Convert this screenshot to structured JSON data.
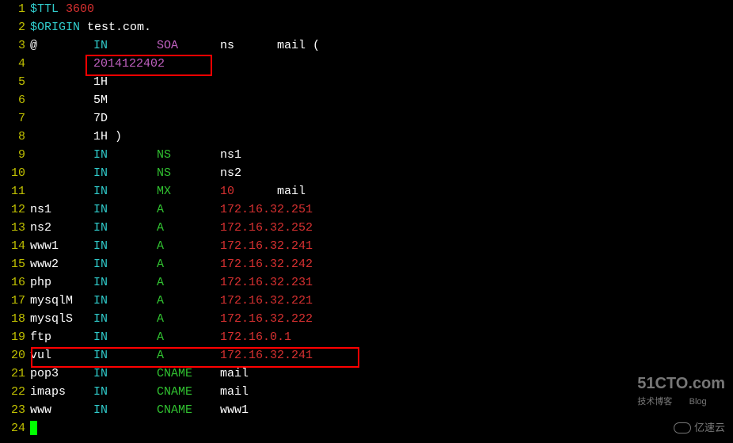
{
  "lines": [
    {
      "n": "1",
      "tokens": [
        {
          "t": "$TTL ",
          "c": "c-cyan"
        },
        {
          "t": "3600",
          "c": "c-red"
        }
      ]
    },
    {
      "n": "2",
      "tokens": [
        {
          "t": "$ORIGIN ",
          "c": "c-cyan"
        },
        {
          "t": "test.com.",
          "c": "c-white"
        }
      ]
    },
    {
      "n": "3",
      "name": "@",
      "class": "IN",
      "type": "SOA",
      "data": "ns      mail (",
      "nameC": "c-white",
      "classC": "c-cyan",
      "typeC": "c-purple",
      "dataC": "c-white"
    },
    {
      "n": "4",
      "indent": true,
      "tokens": [
        {
          "t": "2014122402",
          "c": "c-purple"
        }
      ]
    },
    {
      "n": "5",
      "indent": true,
      "tokens": [
        {
          "t": "1H",
          "c": "c-white"
        }
      ]
    },
    {
      "n": "6",
      "indent": true,
      "tokens": [
        {
          "t": "5M",
          "c": "c-white"
        }
      ]
    },
    {
      "n": "7",
      "indent": true,
      "tokens": [
        {
          "t": "7D",
          "c": "c-white"
        }
      ]
    },
    {
      "n": "8",
      "indent": true,
      "tokens": [
        {
          "t": "1H )",
          "c": "c-white"
        }
      ]
    },
    {
      "n": "9",
      "name": "",
      "class": "IN",
      "type": "NS",
      "data": "ns1",
      "classC": "c-cyan",
      "typeC": "c-green",
      "dataC": "c-white"
    },
    {
      "n": "10",
      "name": "",
      "class": "IN",
      "type": "NS",
      "data": "ns2",
      "classC": "c-cyan",
      "typeC": "c-green",
      "dataC": "c-white"
    },
    {
      "n": "11",
      "name": "",
      "class": "IN",
      "type": "MX",
      "data": "10      mail",
      "classC": "c-cyan",
      "typeC": "c-green",
      "dataC": "c-red",
      "dataTail": "mail",
      "dataTailC": "c-white"
    },
    {
      "n": "12",
      "name": "ns1",
      "class": "IN",
      "type": "A",
      "data": "172.16.32.251",
      "nameC": "c-white",
      "classC": "c-cyan",
      "typeC": "c-green",
      "dataC": "c-red"
    },
    {
      "n": "13",
      "name": "ns2",
      "class": "IN",
      "type": "A",
      "data": "172.16.32.252",
      "nameC": "c-white",
      "classC": "c-cyan",
      "typeC": "c-green",
      "dataC": "c-red"
    },
    {
      "n": "14",
      "name": "www1",
      "class": "IN",
      "type": "A",
      "data": "172.16.32.241",
      "nameC": "c-white",
      "classC": "c-cyan",
      "typeC": "c-green",
      "dataC": "c-red"
    },
    {
      "n": "15",
      "name": "www2",
      "class": "IN",
      "type": "A",
      "data": "172.16.32.242",
      "nameC": "c-white",
      "classC": "c-cyan",
      "typeC": "c-green",
      "dataC": "c-red"
    },
    {
      "n": "16",
      "name": "php",
      "class": "IN",
      "type": "A",
      "data": "172.16.32.231",
      "nameC": "c-white",
      "classC": "c-cyan",
      "typeC": "c-green",
      "dataC": "c-red"
    },
    {
      "n": "17",
      "name": "mysqlM",
      "class": "IN",
      "type": "A",
      "data": "172.16.32.221",
      "nameC": "c-white",
      "classC": "c-cyan",
      "typeC": "c-green",
      "dataC": "c-red"
    },
    {
      "n": "18",
      "name": "mysqlS",
      "class": "IN",
      "type": "A",
      "data": "172.16.32.222",
      "nameC": "c-white",
      "classC": "c-cyan",
      "typeC": "c-green",
      "dataC": "c-red"
    },
    {
      "n": "19",
      "name": "ftp",
      "class": "IN",
      "type": "A",
      "data": "172.16.0.1",
      "nameC": "c-white",
      "classC": "c-cyan",
      "typeC": "c-green",
      "dataC": "c-red"
    },
    {
      "n": "20",
      "name": "vul",
      "class": "IN",
      "type": "A",
      "data": "172.16.32.241",
      "nameC": "c-white",
      "classC": "c-cyan",
      "typeC": "c-green",
      "dataC": "c-red"
    },
    {
      "n": "21",
      "name": "pop3",
      "class": "IN",
      "type": "CNAME",
      "data": "mail",
      "nameC": "c-white",
      "classC": "c-cyan",
      "typeC": "c-green",
      "dataC": "c-white"
    },
    {
      "n": "22",
      "name": "imaps",
      "class": "IN",
      "type": "CNAME",
      "data": "mail",
      "nameC": "c-white",
      "classC": "c-cyan",
      "typeC": "c-green",
      "dataC": "c-white"
    },
    {
      "n": "23",
      "name": "www",
      "class": "IN",
      "type": "CNAME",
      "data": "www1",
      "nameC": "c-white",
      "classC": "c-cyan",
      "typeC": "c-green",
      "dataC": "c-white"
    },
    {
      "n": "24",
      "cursor": true
    }
  ],
  "watermarks": {
    "top": "51CTO.com",
    "topSub": "技术博客",
    "topSubR": "Blog",
    "bottom": "亿速云"
  }
}
